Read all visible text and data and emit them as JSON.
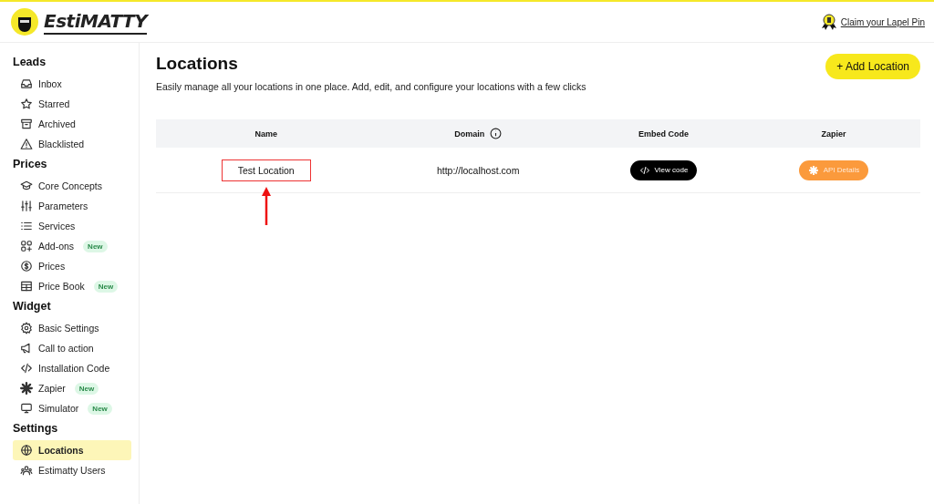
{
  "header": {
    "logo": "EstiMATTY",
    "claim_link": "Claim your Lapel Pin"
  },
  "sidebar": {
    "sections": [
      {
        "title": "Leads",
        "items": [
          {
            "label": "Inbox",
            "selected": false
          },
          {
            "label": "Starred",
            "selected": false
          },
          {
            "label": "Archived",
            "selected": false
          },
          {
            "label": "Blacklisted",
            "selected": false
          }
        ]
      },
      {
        "title": "Prices",
        "items": [
          {
            "label": "Core Concepts",
            "selected": false
          },
          {
            "label": "Parameters",
            "selected": false
          },
          {
            "label": "Services",
            "selected": false
          },
          {
            "label": "Add-ons",
            "selected": false,
            "badge": "New"
          },
          {
            "label": "Prices",
            "selected": false
          },
          {
            "label": "Price Book",
            "selected": false,
            "badge": "New"
          }
        ]
      },
      {
        "title": "Widget",
        "items": [
          {
            "label": "Basic Settings",
            "selected": false
          },
          {
            "label": "Call to action",
            "selected": false
          },
          {
            "label": "Installation Code",
            "selected": false
          },
          {
            "label": "Zapier",
            "selected": false,
            "badge": "New"
          },
          {
            "label": "Simulator",
            "selected": false,
            "badge": "New"
          }
        ]
      },
      {
        "title": "Settings",
        "items": [
          {
            "label": "Locations",
            "selected": true
          },
          {
            "label": "Estimatty Users",
            "selected": false
          }
        ]
      }
    ]
  },
  "page": {
    "title": "Locations",
    "subtitle": "Easily manage all your locations in one place. Add, edit, and configure your locations with a few clicks",
    "add_button": "+ Add Location"
  },
  "table": {
    "columns": [
      "Name",
      "Domain",
      "Embed Code",
      "Zapier"
    ],
    "rows": [
      {
        "name": "Test Location",
        "domain": "http://localhost.com",
        "embed_button": "View code",
        "zapier_button": "API Details",
        "highlighted": true
      }
    ]
  }
}
